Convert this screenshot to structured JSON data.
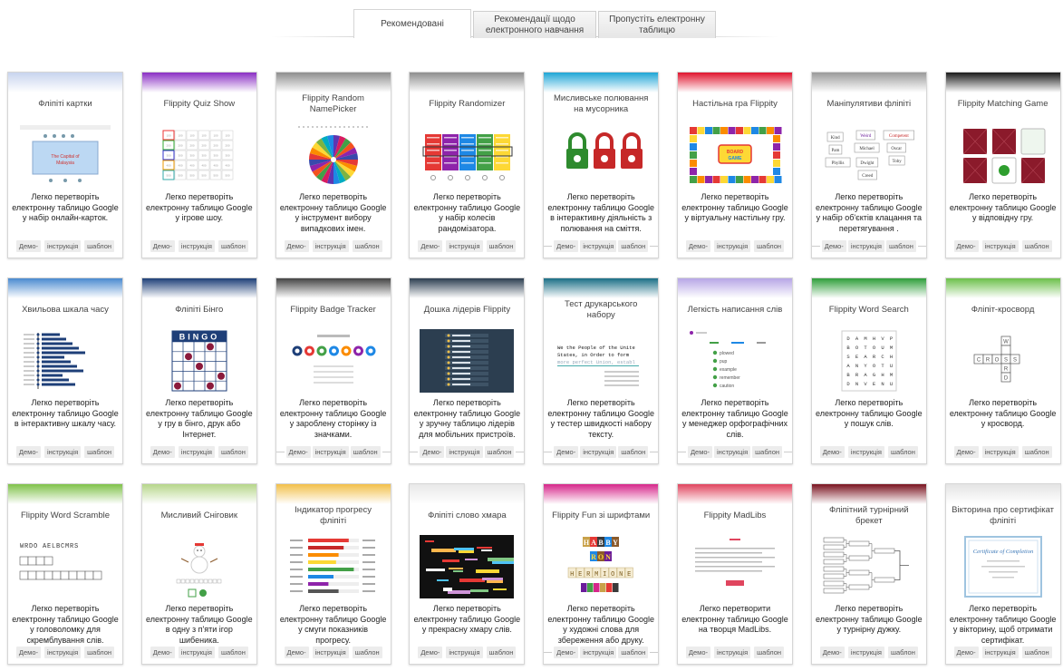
{
  "tabs": [
    {
      "label": "Рекомендовані",
      "active": true
    },
    {
      "label": "Рекомендації щодо електронного навчання",
      "active": false
    },
    {
      "label": "Пропустіть електронну таблицю",
      "active": false
    }
  ],
  "links": {
    "demo": "Демо-",
    "instructions": "інструкція",
    "template": "шаблон"
  },
  "cards": [
    {
      "title": "Фліпіті картки",
      "top": "#c8d4ee",
      "desc": "Легко перетворіть електронну таблицю Google у набір онлайн-карток.",
      "icon": "flashcards-preview-icon"
    },
    {
      "title": "Flippity Quiz Show",
      "top": "#8a2fc4",
      "desc": "Легко перетворіть електронну таблицю Google у ігрове шоу.",
      "icon": "quiz-show-preview-icon"
    },
    {
      "title": "Flippity Random NamePicker",
      "top": "#8e8e8e",
      "desc": "Легко перетворіть електронну таблицю Google у інструмент вибору випадкових імен.",
      "icon": "name-wheel-icon"
    },
    {
      "title": "Flippity Randomizer",
      "top": "#8e8e8e",
      "desc": "Легко перетворіть електронну таблицю Google у набір колесів рандомізатора.",
      "icon": "randomizer-preview-icon"
    },
    {
      "title": "Мисливське полювання на мусорника",
      "top": "#1fa6d6",
      "desc": "Легко перетворіть електронну таблицю Google в інтерактивну діяльність з полювання на сміття.",
      "icon": "padlocks-icon",
      "lined": true
    },
    {
      "title": "Настільна гра Flippity",
      "top": "#e0152e",
      "desc": "Легко перетворіть електронну таблицю Google у віртуальну настільну гру.",
      "icon": "board-game-icon"
    },
    {
      "title": "Маніпулятиви фліпіті",
      "top": "#9a9a9a",
      "desc": "Легко перетворіть електронну таблицю Google у набір об'єктів клацання та перетягування .",
      "icon": "manipulatives-icon",
      "lined": true
    },
    {
      "title": "Flippity Matching Game",
      "top": "#1a1a1a",
      "desc": "Легко перетворіть електронну таблицю Google у відповідну гру.",
      "icon": "matching-cards-icon"
    },
    {
      "title": "Хвильова шкала часу",
      "top": "#4a8ad0",
      "desc": "Легко перетворіть електронну таблицю Google в інтерактивну шкалу часу.",
      "icon": "timeline-icon"
    },
    {
      "title": "Фліпіті Бінго",
      "top": "#1e3f78",
      "desc": "Легко перетворіть електронну таблицю Google у гру в бінго, друк або Інтернет.",
      "icon": "bingo-card-icon"
    },
    {
      "title": "Flippity Badge Tracker",
      "top": "#444444",
      "desc": "Легко перетворіть електронну таблицю Google у зароблену сторінку із значками.",
      "icon": "badges-icon",
      "lined": true
    },
    {
      "title": "Дошка лідерів Flippity",
      "top": "#2c3e50",
      "desc": "Легко перетворіть електронну таблицю Google у зручну таблицю лідерів для мобільних пристроїв.",
      "icon": "leaderboard-icon",
      "lined": true
    },
    {
      "title": "Тест друкарського набору",
      "top": "#1b6f86",
      "desc": "Легко перетворіть електронну таблицю Google у тестер швидкості набору тексту.",
      "icon": "typing-test-icon",
      "lined": true
    },
    {
      "title": "Легкість написання слів",
      "top": "#b7a6e6",
      "desc": "Легко перетворіть електронну таблицю Google у менеджер орфографічних слів.",
      "icon": "spelling-list-icon",
      "lined": true
    },
    {
      "title": "Flippity Word Search",
      "top": "#2e9e3a",
      "desc": "Легко перетворіть електронну таблицю Google у пошук слів.",
      "icon": "word-search-icon"
    },
    {
      "title": "Фліпіт-кросворд",
      "top": "#6cc04a",
      "desc": "Легко перетворіть електронну таблицю Google у кросворд.",
      "icon": "crossword-icon"
    },
    {
      "title": "Flippity Word Scramble",
      "top": "#7fc24a",
      "desc": "Легко перетворіть електронну таблицю Google у головоломку для скремблування слів.",
      "icon": "word-scramble-icon",
      "scramble": "WRDO AELBCMRS"
    },
    {
      "title": "Мисливий Сніговик",
      "top": "#b6d68a",
      "desc": "Легко перетворіть електронну таблицю Google в одну з п'яти ігор шибеника.",
      "icon": "snowman-icon"
    },
    {
      "title": "Індикатор прогресу фліпіті",
      "top": "#f2c04a",
      "desc": "Легко перетворіть електронну таблицю Google у смуги показників прогресу.",
      "icon": "progress-bars-icon"
    },
    {
      "title": "Фліпіті слово хмара",
      "top": "#e8e8e8",
      "desc": "Легко перетворіть електронну таблицю Google у прекрасну хмару слів.",
      "icon": "word-cloud-icon"
    },
    {
      "title": "Flippity Fun зі шрифтами",
      "top": "#d6278a",
      "desc": "Легко перетворіть електронну таблицю Google у художні слова для збереження або друку.",
      "icon": "fun-fonts-icon",
      "lined": true,
      "fontwords": [
        "HABBY",
        "RON",
        "HERMIONE"
      ]
    },
    {
      "title": "Flippity MadLibs",
      "top": "#e0455e",
      "desc": "Легко перетворити електронну таблицю Google на творця MadLibs.",
      "icon": "madlibs-icon"
    },
    {
      "title": "Фліпітний турнірний брекет",
      "top": "#7a1420",
      "desc": "Легко перетворіть електронну таблицю Google у турнірну дужку.",
      "icon": "tournament-bracket-icon"
    },
    {
      "title": "Вікторина про сертифікат фліпіті",
      "top": "#e4e4e4",
      "desc": "Легко перетворіть електронну таблицю Google у вікторину, щоб отримати сертифікат.",
      "icon": "certificate-icon",
      "cert": "Certificate of Completion"
    }
  ],
  "colors": {
    "tab_border": "#cfcfcf",
    "link_bg": "#ececec"
  }
}
